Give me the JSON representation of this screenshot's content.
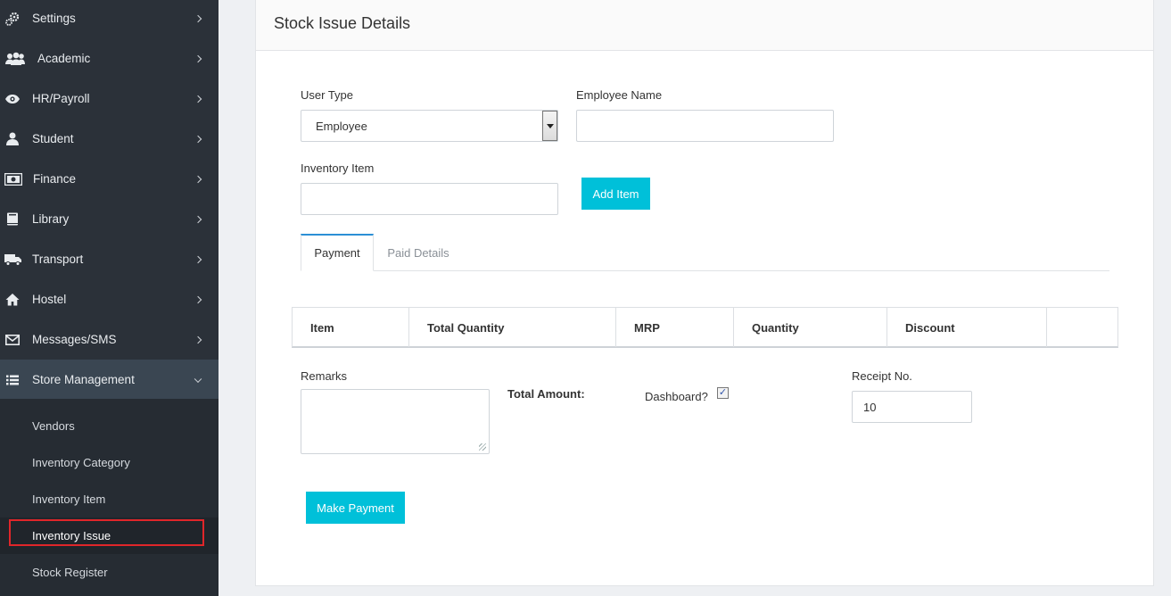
{
  "sidebar": {
    "items": [
      {
        "label": "Settings",
        "icon": "gears-icon"
      },
      {
        "label": "Academic",
        "icon": "users-icon"
      },
      {
        "label": "HR/Payroll",
        "icon": "eye-icon"
      },
      {
        "label": "Student",
        "icon": "user-icon"
      },
      {
        "label": "Finance",
        "icon": "money-icon"
      },
      {
        "label": "Library",
        "icon": "book-icon"
      },
      {
        "label": "Transport",
        "icon": "truck-icon"
      },
      {
        "label": "Hostel",
        "icon": "home-icon"
      },
      {
        "label": "Messages/SMS",
        "icon": "envelope-icon"
      },
      {
        "label": "Store Management",
        "icon": "list-icon",
        "expanded": true
      }
    ],
    "subitems": [
      {
        "label": "Vendors"
      },
      {
        "label": "Inventory Category"
      },
      {
        "label": "Inventory Item"
      },
      {
        "label": "Inventory Issue",
        "selected": true
      },
      {
        "label": "Stock Register"
      }
    ]
  },
  "panel": {
    "title": "Stock Issue Details",
    "user_type": {
      "label": "User Type",
      "value": "Employee"
    },
    "employee_name": {
      "label": "Employee Name",
      "value": ""
    },
    "inventory_item": {
      "label": "Inventory Item",
      "value": ""
    },
    "add_item_label": "Add Item",
    "tabs": [
      {
        "label": "Payment",
        "active": true
      },
      {
        "label": "Paid Details",
        "active": false
      }
    ],
    "table": {
      "headers": [
        "Item",
        "Total Quantity",
        "MRP",
        "Quantity",
        "Discount",
        ""
      ]
    },
    "remarks_label": "Remarks",
    "total_amount_label": "Total Amount:",
    "dashboard_label": "Dashboard?",
    "dashboard_checked": true,
    "receipt": {
      "label": "Receipt No.",
      "value": "10"
    },
    "make_payment_label": "Make Payment"
  },
  "colors": {
    "sidebar_bg": "#2b3139",
    "accent_button": "#00c0d9",
    "highlight_box": "#e0262a",
    "tab_accent": "#2c8fd6"
  }
}
